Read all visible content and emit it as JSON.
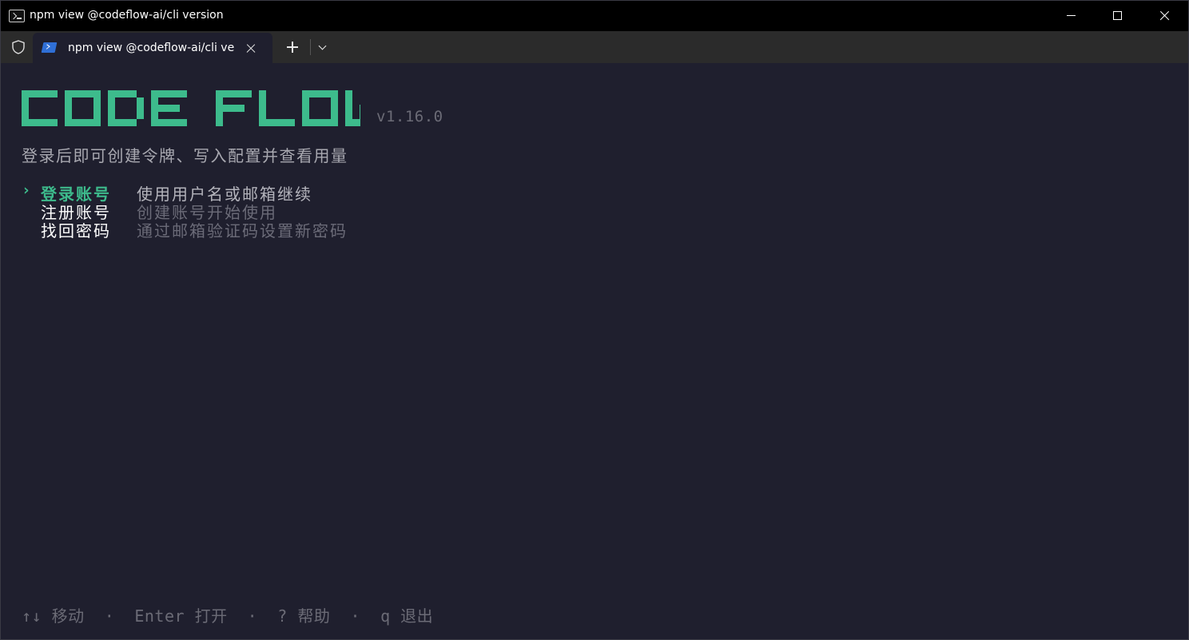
{
  "window": {
    "title": "npm view @codeflow-ai/cli version",
    "icons": [
      "terminal-icon",
      "minimize-icon",
      "maximize-icon",
      "close-icon"
    ]
  },
  "tabbar": {
    "tab_label": "npm view @codeflow-ai/cli ve",
    "icons": [
      "shield-icon",
      "powershell-icon",
      "close-icon",
      "plus-icon",
      "chevron-down-icon"
    ]
  },
  "app": {
    "logo_text": "CODE FLOW",
    "logo_color": "#3dbb8c",
    "version": "v1.16.0",
    "subtitle": "登录后即可创建令牌、写入配置并查看用量",
    "menu": [
      {
        "caret": "›",
        "label": "登录账号",
        "desc": "使用用户名或邮箱继续",
        "selected": true
      },
      {
        "caret": "",
        "label": "注册账号",
        "desc": "创建账号开始使用",
        "selected": false
      },
      {
        "caret": "",
        "label": "找回密码",
        "desc": "通过邮箱验证码设置新密码",
        "selected": false
      }
    ],
    "hint": "↑↓ 移动  ·  Enter 打开  ·  ? 帮助  ·  q 退出"
  }
}
